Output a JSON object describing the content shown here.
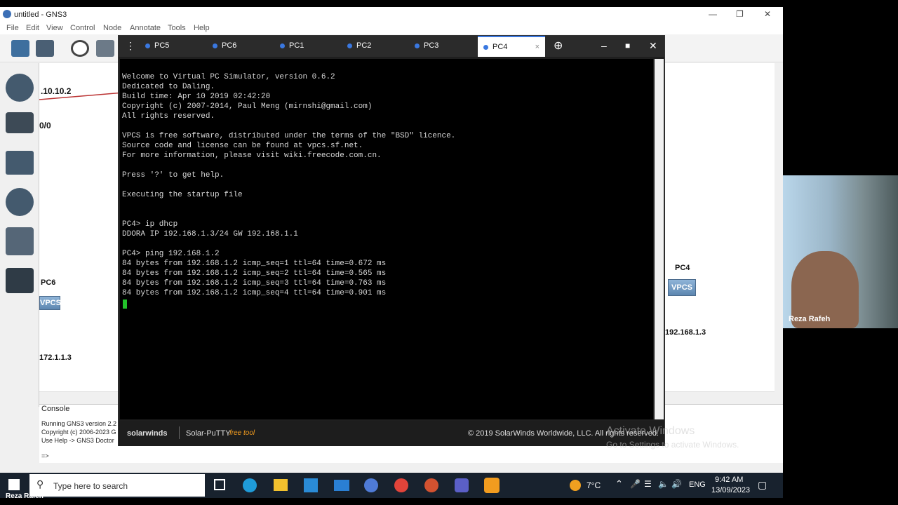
{
  "window": {
    "title": "untitled - GNS3"
  },
  "menu": [
    "File",
    "Edit",
    "View",
    "Control",
    "Node",
    "Annotate",
    "Tools",
    "Help"
  ],
  "canvas": {
    "labels": {
      "link_top": ".10.10.2",
      "intf": "0/0",
      "pc6": "PC6",
      "pc6_ip": "172.1.1.3",
      "pc4": "PC4",
      "pc4_ip": "192.168.1.3",
      "vpcs": "VPCS"
    }
  },
  "console": {
    "title": "Console",
    "lines": [
      "Running GNS3 version 2.2",
      "Copyright (c) 2006-2023 G",
      "Use Help -> GNS3 Doctor",
      "=>"
    ]
  },
  "putty": {
    "tabs": [
      "PC5",
      "PC6",
      "PC1",
      "PC2",
      "PC3",
      "PC4"
    ],
    "active_tab": "PC4",
    "terminal": [
      "Welcome to Virtual PC Simulator, version 0.6.2",
      "Dedicated to Daling.",
      "Build time: Apr 10 2019 02:42:20",
      "Copyright (c) 2007-2014, Paul Meng (mirnshi@gmail.com)",
      "All rights reserved.",
      "",
      "VPCS is free software, distributed under the terms of the \"BSD\" licence.",
      "Source code and license can be found at vpcs.sf.net.",
      "For more information, please visit wiki.freecode.com.cn.",
      "",
      "Press '?' to get help.",
      "",
      "Executing the startup file",
      "",
      "",
      "PC4> ip dhcp",
      "DDORA IP 192.168.1.3/24 GW 192.168.1.1",
      "",
      "PC4> ping 192.168.1.2",
      "84 bytes from 192.168.1.2 icmp_seq=1 ttl=64 time=0.672 ms",
      "84 bytes from 192.168.1.2 icmp_seq=2 ttl=64 time=0.565 ms",
      "84 bytes from 192.168.1.2 icmp_seq=3 ttl=64 time=0.763 ms",
      "84 bytes from 192.168.1.2 icmp_seq=4 ttl=64 time=0.901 ms"
    ],
    "footer": {
      "brand": "solarwinds",
      "product": "Solar-PuTTY",
      "free": "free tool",
      "copyright": "© 2019 SolarWinds Worldwide, LLC. All rights reserved."
    }
  },
  "watermark": {
    "line1": "Activate Windows",
    "line2": "Go to Settings to activate Windows."
  },
  "webcam": {
    "name": "Reza Rafeh"
  },
  "taskbar": {
    "search_placeholder": "Type here to search",
    "weather": "7°C",
    "lang": "ENG",
    "time": "9:42 AM",
    "date": "13/09/2023"
  },
  "presenter_label": "Reza Rafeh"
}
